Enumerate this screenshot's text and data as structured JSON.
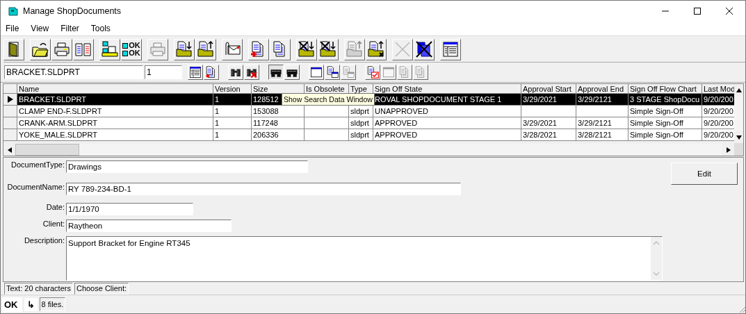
{
  "window": {
    "title": "Manage ShopDocuments"
  },
  "menu": [
    {
      "label": "File"
    },
    {
      "label": "View"
    },
    {
      "label": "Filter"
    },
    {
      "label": "Tools"
    }
  ],
  "toolbar": {
    "groups": [
      [
        {
          "disabled": false
        }
      ],
      [
        {
          "disabled": false
        },
        {
          "disabled": false
        },
        {
          "disabled": false
        }
      ],
      [
        {
          "disabled": false
        },
        {
          "disabled": false,
          "lines": [
            "OK",
            "OK"
          ]
        }
      ],
      [
        {
          "disabled": true
        }
      ],
      [
        {
          "disabled": false
        },
        {
          "disabled": false
        }
      ],
      [
        {
          "disabled": false
        }
      ],
      [
        {
          "disabled": false
        },
        {
          "disabled": false
        }
      ],
      [
        {
          "disabled": false
        },
        {
          "disabled": false
        }
      ],
      [
        {
          "disabled": true
        },
        {
          "disabled": false
        }
      ],
      [
        {
          "disabled": true
        },
        {
          "disabled": false
        }
      ],
      [
        {
          "disabled": false
        }
      ]
    ]
  },
  "search_bar": {
    "name_field": "BRACKET.SLDPRT",
    "version_field": "1",
    "groups": [
      [
        {
          "disabled": false,
          "pressed": false
        },
        {
          "disabled": false,
          "pressed": false
        }
      ],
      [
        {
          "disabled": false,
          "pressed": false
        },
        {
          "disabled": false,
          "pressed": false
        }
      ],
      [
        {
          "disabled": false,
          "pressed": true
        },
        {
          "disabled": false,
          "pressed": false
        }
      ],
      [
        {
          "disabled": false,
          "pressed": false
        },
        {
          "disabled": false,
          "pressed": false
        },
        {
          "disabled": true,
          "pressed": false
        }
      ],
      [
        {
          "disabled": false,
          "pressed": false
        },
        {
          "disabled": true,
          "pressed": false
        },
        {
          "disabled": true,
          "pressed": false
        },
        {
          "disabled": true,
          "pressed": false
        }
      ]
    ]
  },
  "table": {
    "columns": [
      "Name",
      "Version",
      "Size",
      "Is Obsolete",
      "Type",
      "Sign Off State",
      "Approval Start",
      "Approval End",
      "Sign Off Flow Chart",
      "Last Mod"
    ],
    "rows": [
      {
        "selected": true,
        "cells": [
          "BRACKET.SLDPRT",
          "1",
          "128512",
          null,
          null,
          "ROVAL SHOPDOCUMENT STAGE 1",
          "3/29/2021",
          "3/29/2121",
          "3 STAGE ShopDocu",
          "9/20/200"
        ]
      },
      {
        "selected": false,
        "cells": [
          "CLAMP END-F.SLDPRT",
          "1",
          "153088",
          null,
          "sldprt",
          "UNAPPROVED",
          null,
          null,
          "Simple Sign-Off",
          "9/20/200"
        ]
      },
      {
        "selected": false,
        "cells": [
          "CRANK-ARM.SLDPRT",
          "1",
          "117248",
          null,
          "sldprt",
          "APPROVED",
          "3/29/2021",
          "3/29/2121",
          "Simple Sign-Off",
          "9/20/200"
        ]
      },
      {
        "selected": false,
        "cells": [
          "YOKE_MALE.SLDPRT",
          "1",
          "206336",
          null,
          "sldprt",
          "APPROVED",
          "3/28/2021",
          "3/28/2121",
          "Simple Sign-Off",
          "9/20/200"
        ]
      }
    ]
  },
  "tooltip": "Show Search Data Window",
  "form": {
    "fields": [
      {
        "label": "DocumentType:",
        "value": "Drawings",
        "kind": "text"
      },
      {
        "label": "DocumentName:",
        "value": "RY 789-234-BD-1",
        "kind": "text"
      },
      {
        "label": "Date:",
        "value": "1/1/1970",
        "kind": "text"
      },
      {
        "label": "Client:",
        "value": "Raytheon",
        "kind": "text"
      },
      {
        "label": "Description:",
        "value": "Support Bracket for Engine RT345",
        "kind": "multiline"
      }
    ],
    "edit_button": {
      "label": "Edit"
    }
  },
  "status_bar": [
    "Text: 20 characters",
    "Choose Client:"
  ],
  "footer": {
    "ok": "OK",
    "arrow": "↳",
    "count": "8 files."
  }
}
